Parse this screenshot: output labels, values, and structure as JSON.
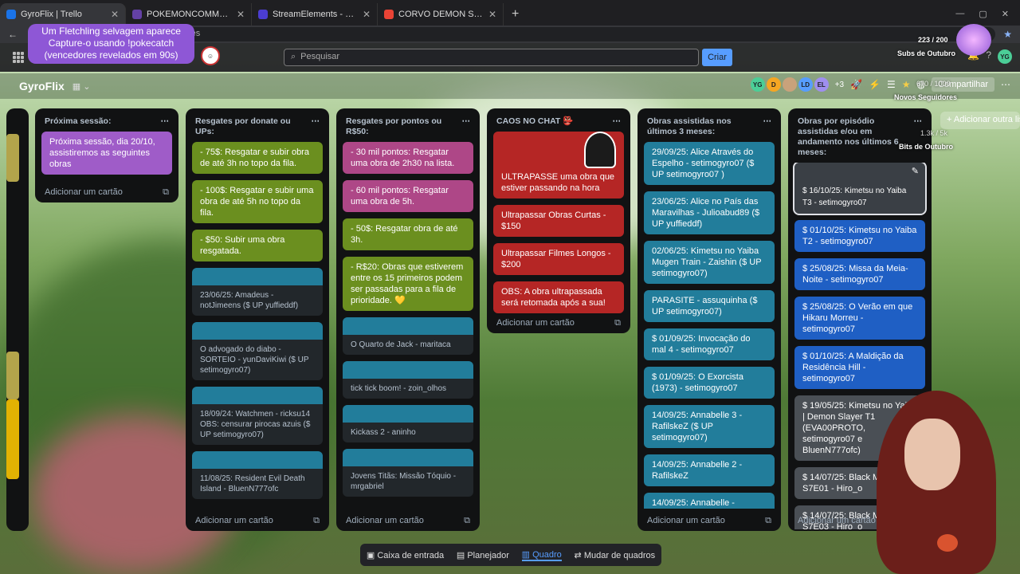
{
  "browser": {
    "tabs": [
      {
        "title": "GyroFlix | Trello",
        "active": true,
        "color": "#1a73e8"
      },
      {
        "title": "POKEMONCOMMUNITYGAME",
        "active": false,
        "color": "#6441a5"
      },
      {
        "title": "StreamElements - Songrequest",
        "active": false,
        "color": "#4b3dd1"
      },
      {
        "title": "CORVO DEMON SLAYER - Pesqui",
        "active": false,
        "color": "#ea4335"
      }
    ],
    "url": "res"
  },
  "overlay": {
    "poke_line1": "Um Fletchling selvagem aparece",
    "poke_line2": "Capture-o usando !pokecatch",
    "poke_line3": "(vencedores revelados em 90s)",
    "subs_count": "223 / 200",
    "subs_label": "Subs de Outubro",
    "followers_count": "670 / 1000",
    "followers_label": "Novos Seguidores",
    "bits_count": "1.3k / 5k",
    "bits_label": "Bits de Outubro"
  },
  "header": {
    "search_placeholder": "Pesquisar",
    "create_label": "Criar",
    "avatar_initials": "YG"
  },
  "board": {
    "name": "GyroFlix",
    "member_count": "+3",
    "share_label": "Compartilhar",
    "add_list": "Adicionar outra lista",
    "member_initials": [
      "YG",
      "D",
      "",
      "LD",
      "EL"
    ]
  },
  "lists": [
    {
      "title": "Próxima sessão:",
      "add": "Adicionar um cartão",
      "cards": [
        {
          "text": "Próxima sessão, dia 20/10, assistiremos as seguintes obras",
          "color": "purple"
        }
      ]
    },
    {
      "title": "Resgates por donate ou UPs:",
      "add": "Adicionar um cartão",
      "cards": [
        {
          "text": "- 75$: Resgatar e subir obra de até 3h no topo da fila.",
          "color": "green"
        },
        {
          "text": "- 100$: Resgatar e subir uma obra de até 5h no topo da fila.",
          "color": "green"
        },
        {
          "text": "- $50: Subir uma obra resgatada.",
          "color": "green"
        },
        {
          "text": "23/06/25: Amadeus - notJimeens ($ UP yuffieddf)",
          "color": "dark"
        },
        {
          "text": "O advogado do diabo - SORTEIO - yunDaviKiwi ($ UP setimogyro07)",
          "color": "dark"
        },
        {
          "text": "18/09/24: Watchmen - ricksu14 OBS: censurar pirocas azuis ($ UP setimogyro07)",
          "color": "dark"
        },
        {
          "text": "11/08/25: Resident Evil Death Island - BluenN777ofc",
          "color": "dark"
        }
      ]
    },
    {
      "title": "Resgates por pontos ou R$50:",
      "add": "Adicionar um cartão",
      "cards": [
        {
          "text": "- 30 mil pontos: Resgatar uma obra de 2h30 na lista.",
          "color": "pink"
        },
        {
          "text": "- 60 mil pontos: Resgatar uma obra de 5h.",
          "color": "pink"
        },
        {
          "text": "- 50$: Resgatar obra de até 3h.",
          "color": "green"
        },
        {
          "text": "- R$20: Obras que estiverem entre os 15 primeiros podem ser passadas para a fila de prioridade. 💛",
          "color": "green"
        },
        {
          "text": "O Quarto de Jack - maritaca",
          "color": "dark"
        },
        {
          "text": "tick tick boom! - zoin_olhos",
          "color": "dark"
        },
        {
          "text": "Kickass 2 - aninho",
          "color": "dark"
        },
        {
          "text": "Jovens Titãs: Missão Tóquio - mrgabriel",
          "color": "dark"
        }
      ]
    },
    {
      "title": "CAOS NO CHAT 👺",
      "add": "Adicionar um cartão",
      "cards": [
        {
          "text": "ULTRAPASSE uma obra que estiver passando na hora",
          "color": "red"
        },
        {
          "text": "Ultrapassar Obras Curtas - $150",
          "color": "red"
        },
        {
          "text": "Ultrapassar Filmes Longos - $200",
          "color": "red"
        },
        {
          "text": "OBS: A obra ultrapassada será retomada após a sua!",
          "color": "red"
        }
      ]
    },
    {
      "title": "Obras assistidas nos últimos 3 meses:",
      "add": "Adicionar um cartão",
      "cards": [
        {
          "text": "29/09/25: Alice Através do Espelho - setimogyro07 ($ UP setimogyro07 )",
          "color": "teal"
        },
        {
          "text": "23/06/25: Alice no País das Maravilhas - Julioabud89 ($ UP yuffieddf)",
          "color": "teal"
        },
        {
          "text": "02/06/25: Kimetsu no Yaiba Mugen Train - Zaishin ($ UP setimogyro07)",
          "color": "teal"
        },
        {
          "text": "PARASITE - assuquinha ($ UP setimogyro07)",
          "color": "teal"
        },
        {
          "text": "$ 01/09/25: Invocação do mal 4 - setimogyro07",
          "color": "teal"
        },
        {
          "text": "$ 01/09/25: O Exorcista (1973) - setimogyro07",
          "color": "teal"
        },
        {
          "text": "14/09/25: Annabelle 3 - RafilskeZ ($ UP setimogyro07)",
          "color": "teal"
        },
        {
          "text": "14/09/25: Annabelle 2 - RafilskeZ",
          "color": "teal"
        },
        {
          "text": "14/09/25: Annabelle -",
          "color": "teal"
        }
      ]
    },
    {
      "title": "Obras por episódio assistidas e/ou em andamento nos últimos 6 meses:",
      "add": "Adicionar um cartão",
      "cards": [
        {
          "text": "$ 16/10/25: Kimetsu no Yaiba T3 - setimogyro07",
          "color": "sel"
        },
        {
          "text": "$ 01/10/25: Kimetsu no Yaiba T2 - setimogyro07",
          "color": "blue"
        },
        {
          "text": "$ 25/08/25: Missa da Meia-Noite - setimogyro07",
          "color": "blue"
        },
        {
          "text": "$ 25/08/25: O Verão em que Hikaru Morreu - setimogyro07",
          "color": "blue"
        },
        {
          "text": "$ 01/10/25: A Maldição da Residência Hill - setimogyro07",
          "color": "blue"
        },
        {
          "text": "$ 19/05/25: Kimetsu no Yaiba | Demon Slayer T1 (EVA00PROTO, setimogyro07 e BluenN777ofc)",
          "color": "gray"
        },
        {
          "text": "$ 14/07/25: Black Mirror S7E01 - Hiro_o",
          "color": "gray"
        },
        {
          "text": "$ 14/07/25: Black Mirror S7E03 - Hiro_o",
          "color": "gray"
        }
      ]
    }
  ],
  "bottomnav": {
    "inbox": "Caixa de entrada",
    "planner": "Planejador",
    "board": "Quadro",
    "switch": "Mudar de quadros"
  }
}
